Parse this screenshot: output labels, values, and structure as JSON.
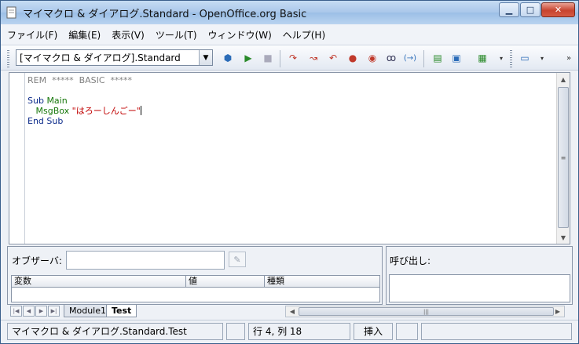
{
  "window": {
    "title": "マイマクロ & ダイアログ.Standard - OpenOffice.org Basic",
    "minimize": "▁",
    "maximize": "□",
    "close": "✕"
  },
  "menu": [
    "ファイル(F)",
    "編集(E)",
    "表示(V)",
    "ツール(T)",
    "ウィンドウ(W)",
    "ヘルプ(H)"
  ],
  "toolbar": {
    "library_value": "[マイマクロ & ダイアログ].Standard",
    "icons": [
      "compile-icon",
      "run-icon",
      "stop-icon",
      "step-into-icon",
      "step-over-icon",
      "step-out-icon",
      "breakpoint-icon",
      "manage-breakpoints-icon",
      "watch-icon",
      "find-parentheses-icon",
      "insert-source-icon",
      "save-source-icon",
      "import-dialog-icon",
      "more-icon"
    ]
  },
  "code": {
    "line1": "REM  *****  BASIC  *****",
    "sub_kw": "Sub",
    "sub_name": "Main",
    "msgbox_kw": "MsgBox",
    "msgbox_arg": "\"はろーしんごー\"",
    "end_sub": "End Sub"
  },
  "watch": {
    "label": "オブザーバ:",
    "input_value": "",
    "columns": [
      "変数",
      "値",
      "種類"
    ]
  },
  "calls": {
    "label": "呼び出し:"
  },
  "tabs": [
    "Module1",
    "Test"
  ],
  "status": {
    "document": "マイマクロ & ダイアログ.Standard.Test",
    "position": "行 4, 列 18",
    "mode": "挿入"
  },
  "colors": {
    "comment": "#808080",
    "keyword": "#0b2a8a",
    "identifier": "#16770a",
    "string": "#c00000"
  }
}
